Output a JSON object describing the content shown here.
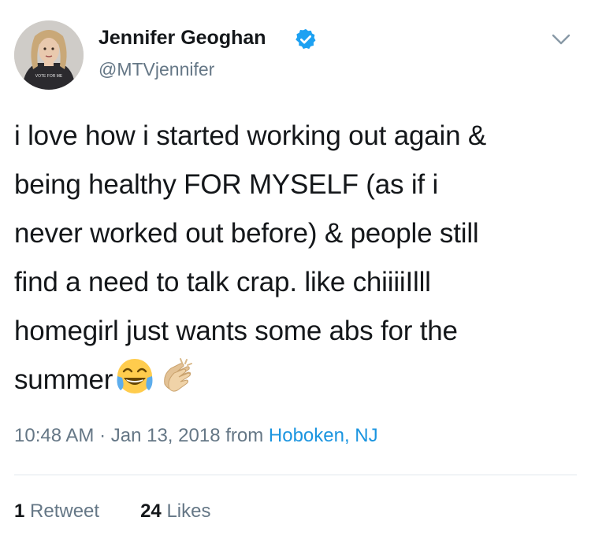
{
  "author": {
    "name": "Jennifer Geoghan",
    "handle": "@MTVjennifer",
    "verified": true,
    "avatar_shirt_text": "VOTE FOR ME"
  },
  "tweet": {
    "lines": [
      "i love how i started working out again &",
      "being healthy FOR MYSELF (as if i",
      "never worked out before) & people still",
      "find a need to talk crap. like chiiiiIlll",
      "homegirl just wants some abs for the",
      "summer"
    ],
    "emojis": [
      "face-with-tears-of-joy-icon",
      "clapping-hands-icon"
    ]
  },
  "meta": {
    "time": "10:48 AM",
    "separator": "·",
    "date": "Jan 13, 2018",
    "from_label": "from",
    "location": "Hoboken, NJ"
  },
  "stats": {
    "retweets_count": "1",
    "retweets_label": "Retweet",
    "likes_count": "24",
    "likes_label": "Likes"
  },
  "colors": {
    "text": "#14171a",
    "secondary": "#657786",
    "link": "#1b95e0",
    "verified": "#1da1f2",
    "divider": "#e1e8ed"
  }
}
